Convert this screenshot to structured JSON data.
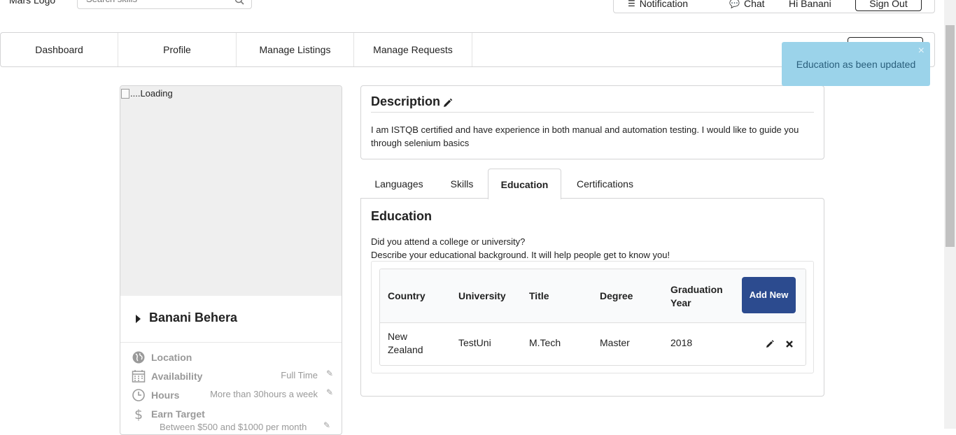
{
  "header": {
    "logo": "Mars Logo",
    "search_placeholder": "Search skills",
    "notification": "Notification",
    "chat": "Chat",
    "greeting": "Hi Banani",
    "sign_out": "Sign Out"
  },
  "nav": {
    "items": [
      "Dashboard",
      "Profile",
      "Manage Listings",
      "Manage Requests"
    ]
  },
  "toast": {
    "message": "Education as been updated",
    "close": "×"
  },
  "profile": {
    "photo_alt": "....Loading",
    "name": "Banani Behera",
    "location_label": "Location",
    "availability_label": "Availability",
    "availability_value": "Full Time",
    "hours_label": "Hours",
    "hours_value": "More than 30hours a week",
    "earn_label": "Earn Target",
    "earn_value": "Between $500 and $1000 per month"
  },
  "description": {
    "title": "Description",
    "text": "I am ISTQB certified and have experience in both manual and automation testing. I would like to guide you through selenium basics"
  },
  "tabs": {
    "items": [
      "Languages",
      "Skills",
      "Education",
      "Certifications"
    ],
    "active": "Education"
  },
  "education": {
    "title": "Education",
    "question": "Did you attend a college or university?",
    "prompt": "Describe your educational background. It will help people get to know you!",
    "columns": [
      "Country",
      "University",
      "Title",
      "Degree",
      "Graduation Year"
    ],
    "add_new": "Add New",
    "rows": [
      {
        "country": "New Zealand",
        "university": "TestUni",
        "title": "M.Tech",
        "degree": "Master",
        "year": "2018"
      }
    ]
  },
  "colors": {
    "accent": "#2c4b8f",
    "toast_bg": "#9bd3ea",
    "toast_text": "#2a5f7c"
  }
}
